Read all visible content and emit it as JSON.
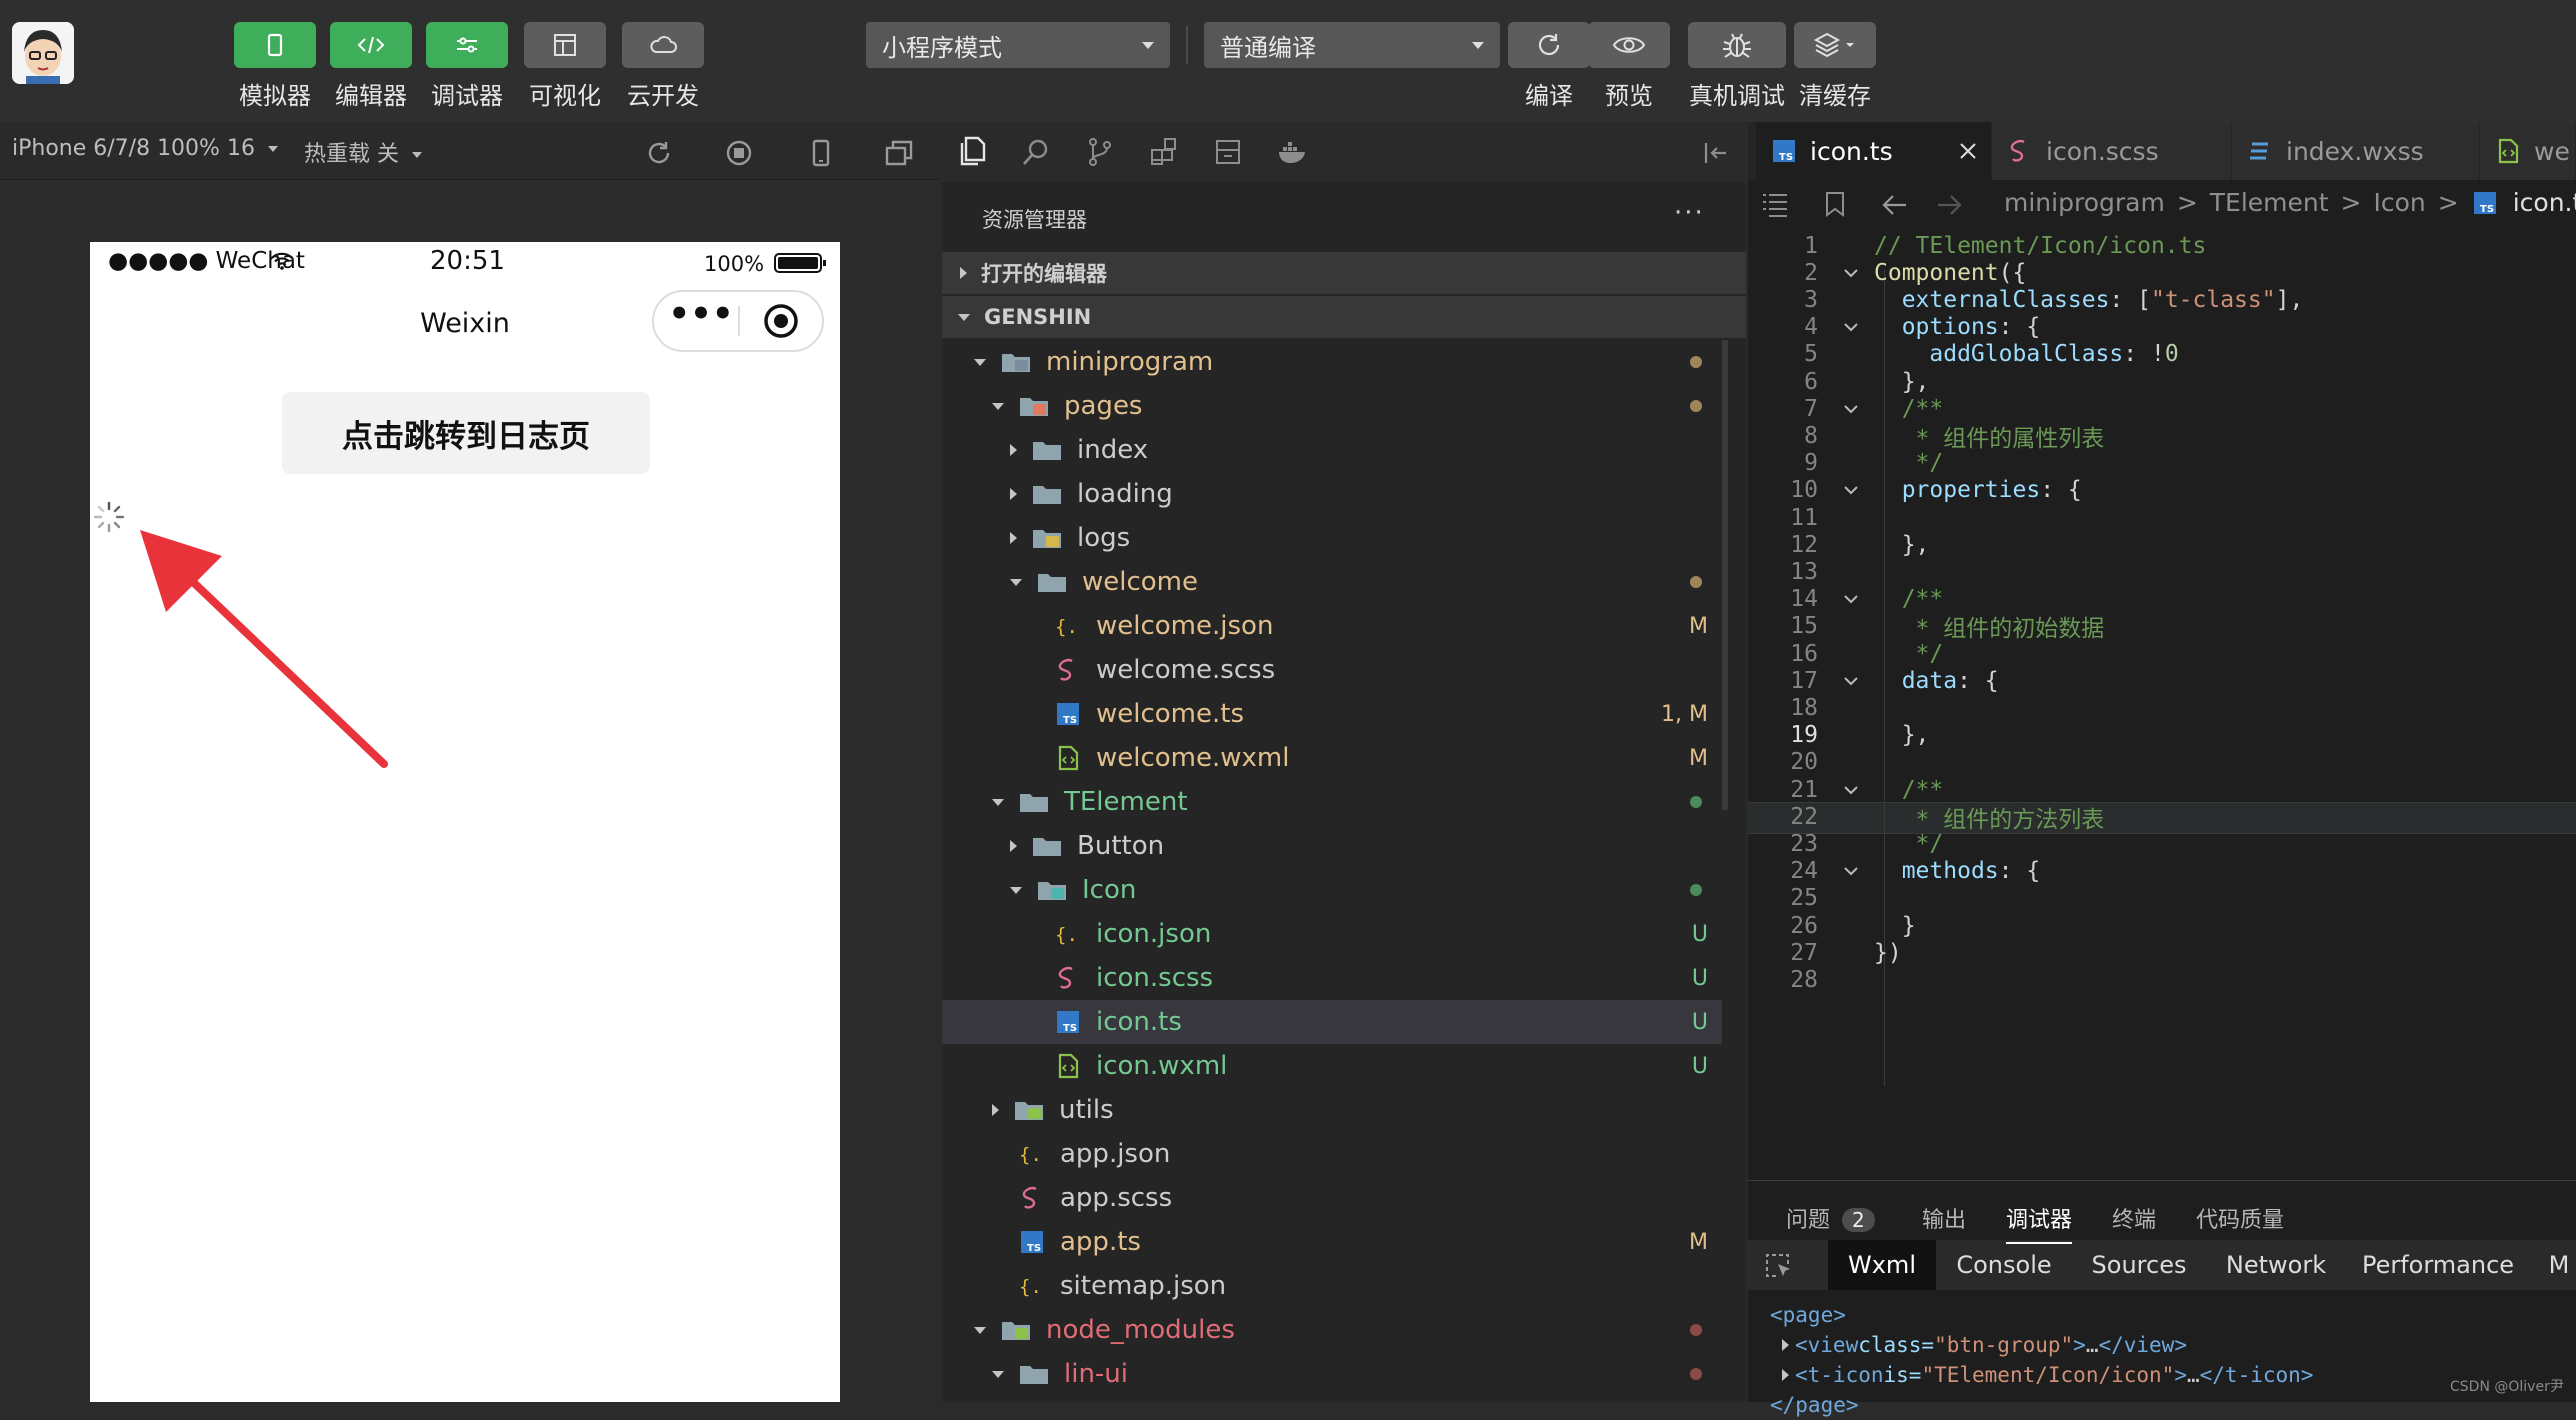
{
  "toolbar": {
    "buttons": [
      {
        "label": "模拟器",
        "icon": "phone-icon"
      },
      {
        "label": "编辑器",
        "icon": "code-icon"
      },
      {
        "label": "调试器",
        "icon": "sliders-icon"
      },
      {
        "label": "可视化",
        "icon": "layout-icon"
      },
      {
        "label": "云开发",
        "icon": "cloud-icon"
      }
    ],
    "mode_select": "小程序模式",
    "compile_select": "普通编译",
    "right_buttons": [
      {
        "label": "编译",
        "icon": "refresh-icon"
      },
      {
        "label": "预览",
        "icon": "eye-icon"
      },
      {
        "label": "真机调试",
        "icon": "bug-icon"
      },
      {
        "label": "清缓存",
        "icon": "layers-icon"
      }
    ]
  },
  "simulator": {
    "device": "iPhone 6/7/8 100% 16",
    "hotreload": "热重载 关",
    "status_carrier": "●●●●● WeChat",
    "status_time": "20:51",
    "status_battery": "100%",
    "nav_title": "Weixin",
    "capsule_more": "•••",
    "button_text": "点击跳转到日志页"
  },
  "explorer": {
    "title": "资源管理器",
    "more": "···",
    "section_open": "打开的编辑器",
    "section_project": "GENSHIN",
    "rows": [
      {
        "label": "miniprogram",
        "depth": 1,
        "type": "folder-src",
        "open": true,
        "color": "#e2c08d",
        "dot": "#a0855b"
      },
      {
        "label": "pages",
        "depth": 2,
        "type": "folder-pages",
        "open": true,
        "color": "#e2c08d",
        "dot": "#a0855b"
      },
      {
        "label": "index",
        "depth": 3,
        "type": "folder",
        "open": false,
        "color": "#cccccc"
      },
      {
        "label": "loading",
        "depth": 3,
        "type": "folder",
        "open": false,
        "color": "#cccccc"
      },
      {
        "label": "logs",
        "depth": 3,
        "type": "folder-logs",
        "open": false,
        "color": "#cccccc"
      },
      {
        "label": "welcome",
        "depth": 3,
        "type": "folder",
        "open": true,
        "color": "#e2c08d",
        "dot": "#a0855b"
      },
      {
        "label": "welcome.json",
        "depth": 4,
        "type": "json",
        "color": "#e2c08d",
        "badge": "M",
        "badge_color": "#e2c08d"
      },
      {
        "label": "welcome.scss",
        "depth": 4,
        "type": "scss",
        "color": "#cccccc"
      },
      {
        "label": "welcome.ts",
        "depth": 4,
        "type": "ts",
        "color": "#e2c08d",
        "badge": "1, M",
        "badge_color": "#e2c08d"
      },
      {
        "label": "welcome.wxml",
        "depth": 4,
        "type": "wxml",
        "color": "#e2c08d",
        "badge": "M",
        "badge_color": "#e2c08d"
      },
      {
        "label": "TElement",
        "depth": 2,
        "type": "folder",
        "open": true,
        "color": "#73c991",
        "dot": "#4d8a5f"
      },
      {
        "label": "Button",
        "depth": 3,
        "type": "folder",
        "open": false,
        "color": "#cccccc"
      },
      {
        "label": "Icon",
        "depth": 3,
        "type": "folder-icon",
        "open": true,
        "color": "#73c991",
        "dot": "#4d8a5f"
      },
      {
        "label": "icon.json",
        "depth": 4,
        "type": "json",
        "color": "#73c991",
        "badge": "U",
        "badge_color": "#73c991"
      },
      {
        "label": "icon.scss",
        "depth": 4,
        "type": "scss",
        "color": "#73c991",
        "badge": "U",
        "badge_color": "#73c991"
      },
      {
        "label": "icon.ts",
        "depth": 4,
        "type": "ts",
        "color": "#73c991",
        "badge": "U",
        "badge_color": "#73c991",
        "selected": true
      },
      {
        "label": "icon.wxml",
        "depth": 4,
        "type": "wxml",
        "color": "#73c991",
        "badge": "U",
        "badge_color": "#73c991"
      },
      {
        "label": "utils",
        "depth": 2,
        "type": "folder-utils",
        "open": false,
        "color": "#cccccc"
      },
      {
        "label": "app.json",
        "depth": 2,
        "type": "json",
        "color": "#cccccc"
      },
      {
        "label": "app.scss",
        "depth": 2,
        "type": "scss",
        "color": "#cccccc"
      },
      {
        "label": "app.ts",
        "depth": 2,
        "type": "ts",
        "color": "#e2c08d",
        "badge": "M",
        "badge_color": "#e2c08d"
      },
      {
        "label": "sitemap.json",
        "depth": 2,
        "type": "json",
        "color": "#cccccc"
      },
      {
        "label": "node_modules",
        "depth": 1,
        "type": "folder-node",
        "open": true,
        "color": "#e06c75",
        "dot": "#8c4a4a"
      },
      {
        "label": "lin-ui",
        "depth": 2,
        "type": "folder",
        "open": true,
        "color": "#e06c75",
        "dot": "#8c4a4a"
      }
    ]
  },
  "editor": {
    "tabs": [
      {
        "label": "icon.ts",
        "type": "ts",
        "active": true
      },
      {
        "label": "icon.scss",
        "type": "scss",
        "active": false
      },
      {
        "label": "index.wxss",
        "type": "css",
        "active": false
      },
      {
        "label": "we",
        "type": "wxml",
        "active": false
      }
    ],
    "breadcrumb": [
      "miniprogram",
      ">",
      "TElement",
      ">",
      "Icon",
      ">",
      "icon.ts",
      ">",
      "..."
    ],
    "active_line": 19,
    "lines": [
      {
        "n": "1",
        "fold": false,
        "tokens": [
          [
            "c-cm",
            "// TElement/Icon/icon.ts"
          ]
        ]
      },
      {
        "n": "2",
        "fold": true,
        "tokens": [
          [
            "c-fn",
            "Component"
          ],
          [
            "c-op",
            "("
          ],
          [
            "c-op",
            "{"
          ]
        ]
      },
      {
        "n": "3",
        "fold": false,
        "tokens": [
          [
            "c-op",
            "  "
          ],
          [
            "c-prop",
            "externalClasses"
          ],
          [
            "c-op",
            ": ["
          ],
          [
            "c-str",
            "\"t-class\""
          ],
          [
            "c-op",
            "],"
          ]
        ]
      },
      {
        "n": "4",
        "fold": true,
        "tokens": [
          [
            "c-op",
            "  "
          ],
          [
            "c-prop",
            "options"
          ],
          [
            "c-op",
            ": {"
          ]
        ]
      },
      {
        "n": "5",
        "fold": false,
        "tokens": [
          [
            "c-op",
            "    "
          ],
          [
            "c-prop",
            "addGlobalClass"
          ],
          [
            "c-op",
            ": "
          ],
          [
            "c-op",
            "!"
          ],
          [
            "c-num",
            "0"
          ]
        ]
      },
      {
        "n": "6",
        "fold": false,
        "tokens": [
          [
            "c-op",
            "  },"
          ]
        ]
      },
      {
        "n": "7",
        "fold": true,
        "tokens": [
          [
            "c-op",
            "  "
          ],
          [
            "c-cm",
            "/**"
          ]
        ]
      },
      {
        "n": "8",
        "fold": false,
        "tokens": [
          [
            "c-cm",
            "   * 组件的属性列表"
          ]
        ]
      },
      {
        "n": "9",
        "fold": false,
        "tokens": [
          [
            "c-cm",
            "   */"
          ]
        ]
      },
      {
        "n": "10",
        "fold": true,
        "tokens": [
          [
            "c-op",
            "  "
          ],
          [
            "c-prop",
            "properties"
          ],
          [
            "c-op",
            ": {"
          ]
        ]
      },
      {
        "n": "11",
        "fold": false,
        "tokens": []
      },
      {
        "n": "12",
        "fold": false,
        "tokens": [
          [
            "c-op",
            "  },"
          ]
        ]
      },
      {
        "n": "13",
        "fold": false,
        "tokens": []
      },
      {
        "n": "14",
        "fold": true,
        "tokens": [
          [
            "c-op",
            "  "
          ],
          [
            "c-cm",
            "/**"
          ]
        ]
      },
      {
        "n": "15",
        "fold": false,
        "tokens": [
          [
            "c-cm",
            "   * 组件的初始数据"
          ]
        ]
      },
      {
        "n": "16",
        "fold": false,
        "tokens": [
          [
            "c-cm",
            "   */"
          ]
        ]
      },
      {
        "n": "17",
        "fold": true,
        "tokens": [
          [
            "c-op",
            "  "
          ],
          [
            "c-prop",
            "data"
          ],
          [
            "c-op",
            ": {"
          ]
        ]
      },
      {
        "n": "18",
        "fold": false,
        "tokens": []
      },
      {
        "n": "19",
        "fold": false,
        "tokens": [
          [
            "c-op",
            "  },"
          ]
        ]
      },
      {
        "n": "20",
        "fold": false,
        "tokens": []
      },
      {
        "n": "21",
        "fold": true,
        "tokens": [
          [
            "c-op",
            "  "
          ],
          [
            "c-cm",
            "/**"
          ]
        ]
      },
      {
        "n": "22",
        "fold": false,
        "tokens": [
          [
            "c-cm",
            "   * 组件的方法列表"
          ]
        ]
      },
      {
        "n": "23",
        "fold": false,
        "tokens": [
          [
            "c-cm",
            "   */"
          ]
        ]
      },
      {
        "n": "24",
        "fold": true,
        "tokens": [
          [
            "c-op",
            "  "
          ],
          [
            "c-prop",
            "methods"
          ],
          [
            "c-op",
            ": {"
          ]
        ]
      },
      {
        "n": "25",
        "fold": false,
        "tokens": []
      },
      {
        "n": "26",
        "fold": false,
        "tokens": [
          [
            "c-op",
            "  }"
          ]
        ]
      },
      {
        "n": "27",
        "fold": false,
        "tokens": [
          [
            "c-op",
            "}"
          ],
          [
            "c-op",
            ")"
          ]
        ]
      },
      {
        "n": "28",
        "fold": false,
        "tokens": []
      }
    ]
  },
  "panel": {
    "tabs": [
      {
        "label": "问题",
        "count": "2"
      },
      {
        "label": "输出"
      },
      {
        "label": "调试器",
        "active": true
      },
      {
        "label": "终端"
      },
      {
        "label": "代码质量"
      }
    ],
    "devtools_tabs": [
      "Wxml",
      "Console",
      "Sources",
      "Network",
      "Performance",
      "M"
    ],
    "wxml_lines": [
      {
        "indent": 0,
        "arrow": false,
        "tokens": [
          [
            "#6fa8dc",
            "<page>"
          ]
        ]
      },
      {
        "indent": 1,
        "arrow": true,
        "tokens": [
          [
            "#6fa8dc",
            "<view "
          ],
          [
            "#9cdcfe",
            "class="
          ],
          [
            "#ce9178",
            "\"btn-group\""
          ],
          [
            "#6fa8dc",
            ">"
          ],
          [
            "#cccccc",
            "…"
          ],
          [
            "#6fa8dc",
            "</view>"
          ]
        ]
      },
      {
        "indent": 1,
        "arrow": true,
        "tokens": [
          [
            "#6fa8dc",
            "<t-icon "
          ],
          [
            "#9cdcfe",
            "is="
          ],
          [
            "#ce9178",
            "\"TElement/Icon/icon\""
          ],
          [
            "#6fa8dc",
            ">"
          ],
          [
            "#cccccc",
            "…"
          ],
          [
            "#6fa8dc",
            "</t-icon>"
          ]
        ]
      },
      {
        "indent": 0,
        "arrow": false,
        "tokens": [
          [
            "#6fa8dc",
            "</page>"
          ]
        ]
      }
    ],
    "watermark": "CSDN @Oliver尹"
  }
}
